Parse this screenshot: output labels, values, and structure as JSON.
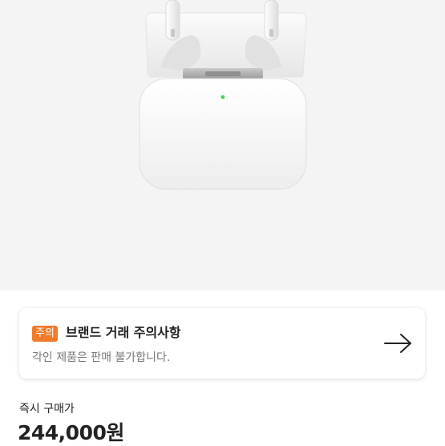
{
  "notice": {
    "badge": "주의",
    "title": "브랜드 거래 주의사항",
    "description": "각인 제품은 판매 불가합니다."
  },
  "price": {
    "label": "즉시 구매가",
    "value": "244,000원"
  },
  "icons": {
    "arrow": "arrow-right-icon",
    "product": "airpods-case-image"
  },
  "colors": {
    "badge": "#f07b2b",
    "hero_background": "#f4f4f4",
    "status_led": "#3fd45a"
  }
}
